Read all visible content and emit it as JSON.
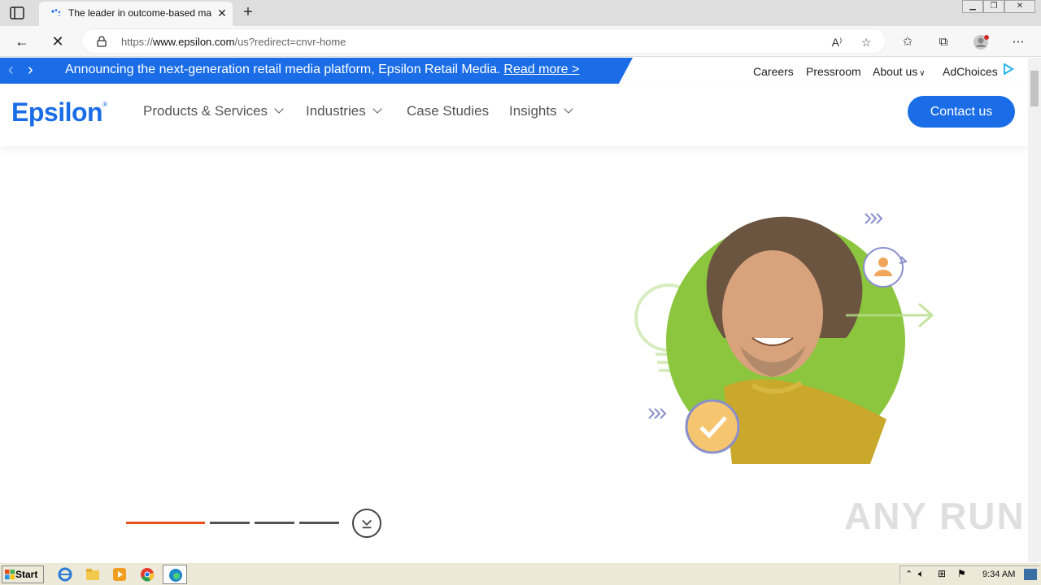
{
  "browser": {
    "tab_title": "The leader in outcome-based ma",
    "url_prefix": "https://",
    "url_domain": "www.epsilon.com",
    "url_path": "/us?redirect=cnvr-home"
  },
  "announcement": {
    "text": "Announcing the next-generation retail media platform, Epsilon Retail Media.",
    "link": "Read more >"
  },
  "utility_nav": {
    "careers": "Careers",
    "pressroom": "Pressroom",
    "about": "About us",
    "adchoices": "AdChoices"
  },
  "header": {
    "logo": "Epsilon",
    "logo_mark": "®",
    "nav": [
      "Products & Services",
      "Industries",
      "Case Studies",
      "Insights"
    ],
    "contact": "Contact us"
  },
  "hero": {
    "slides": 4,
    "active_slide": 1
  },
  "watermark": "ANY RUN",
  "taskbar": {
    "start": "Start",
    "time": "9:34 AM"
  },
  "colors": {
    "brand_blue": "#1a6de6",
    "progress_active": "#e8501c",
    "progress_inactive": "#555555",
    "hero_green": "#8cc63f"
  }
}
